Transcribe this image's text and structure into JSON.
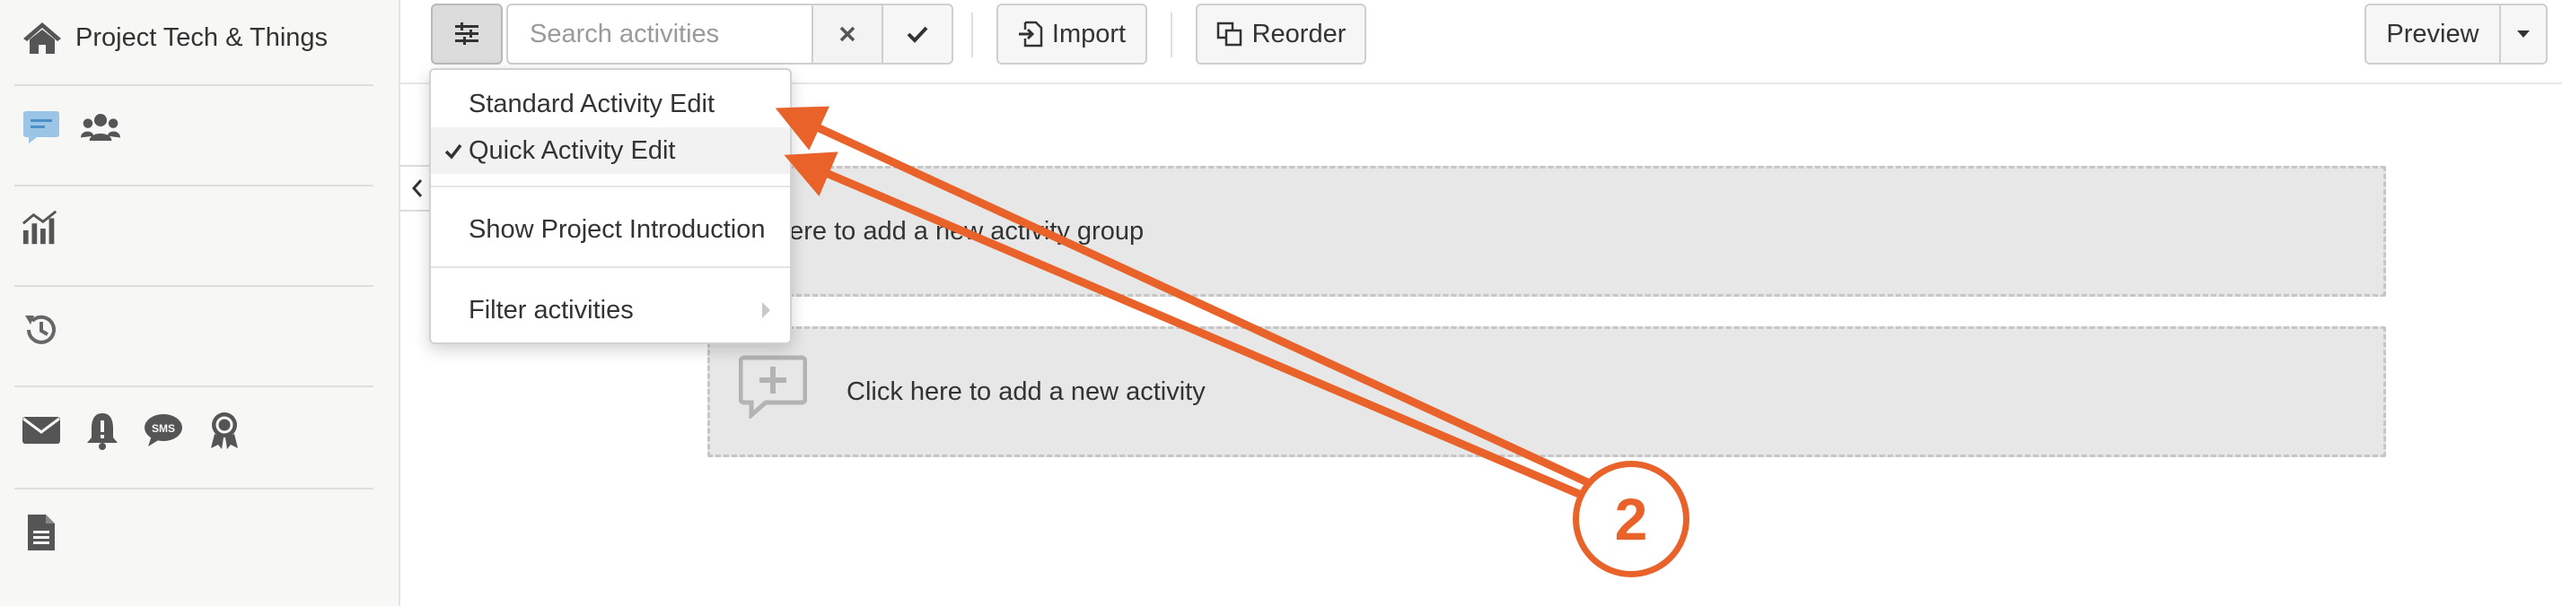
{
  "sidebar": {
    "project_title": "Project Tech & Things",
    "icons": [
      "home-icon",
      "comment-icon",
      "users-icon",
      "analytics-icon",
      "history-icon",
      "email-icon",
      "notification-icon",
      "sms-icon",
      "award-icon",
      "document-icon"
    ]
  },
  "toolbar": {
    "search_placeholder": "Search activities",
    "import_label": "Import",
    "reorder_label": "Reorder",
    "preview_label": "Preview"
  },
  "menu": {
    "items": [
      {
        "label": "Standard Activity Edit",
        "checked": false
      },
      {
        "label": "Quick Activity Edit",
        "checked": true
      },
      {
        "label": "Show Project Introduction",
        "checked": false
      },
      {
        "label": "Filter activities",
        "checked": false,
        "has_submenu": true
      }
    ]
  },
  "content": {
    "add_group_text": "here to add a new activity group",
    "add_activity_text": "Click here to add a new activity"
  },
  "annotation": {
    "number": "2",
    "color": "#e8622a"
  }
}
